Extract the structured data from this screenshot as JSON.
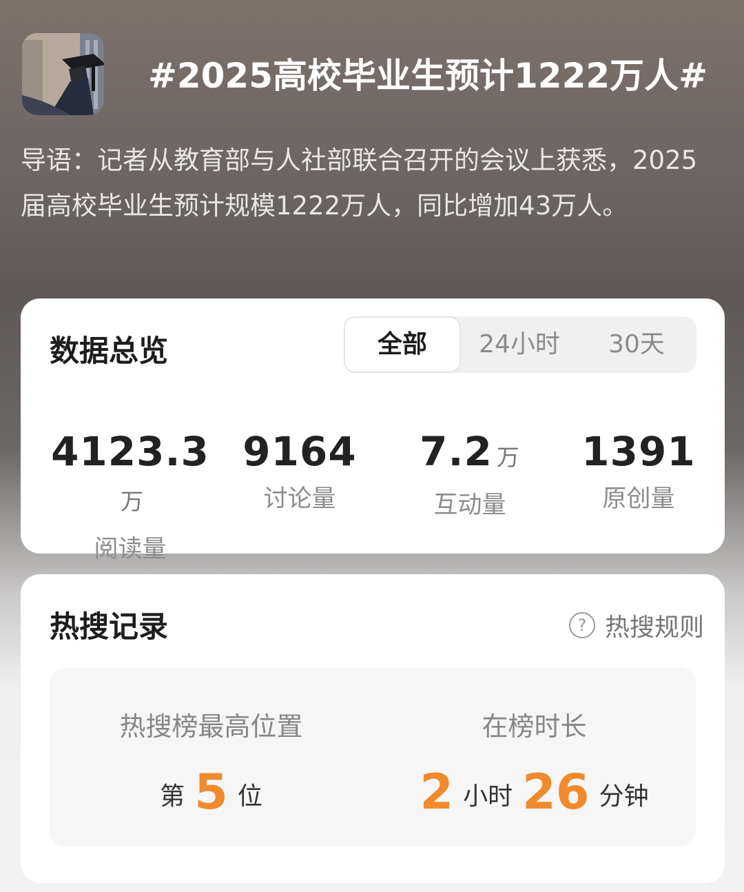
{
  "header": {
    "title": "#2025高校毕业生预计1222万人#",
    "thumbnail_icon": "graduation-photo"
  },
  "intro": "导语：记者从教育部与人社部联合召开的会议上获悉，2025届高校毕业生预计规模1222万人，同比增加43万人。",
  "overview": {
    "title": "数据总览",
    "tabs": [
      "全部",
      "24小时",
      "30天"
    ],
    "active_tab": "全部",
    "stats": [
      {
        "value": "4123.3",
        "unit": "万",
        "label": "阅读量"
      },
      {
        "value": "9164",
        "unit": "",
        "label": "讨论量"
      },
      {
        "value": "7.2",
        "unit": "万",
        "label": "互动量"
      },
      {
        "value": "1391",
        "unit": "",
        "label": "原创量"
      }
    ]
  },
  "hot": {
    "title": "热搜记录",
    "rules_label": "热搜规则",
    "peak_label": "热搜榜最高位置",
    "peak_prefix": "第",
    "peak_value": "5",
    "peak_suffix": "位",
    "duration_label": "在榜时长",
    "hours": "2",
    "hours_unit": "小时",
    "minutes": "26",
    "minutes_unit": "分钟",
    "accent_color": "#f08a2c"
  }
}
